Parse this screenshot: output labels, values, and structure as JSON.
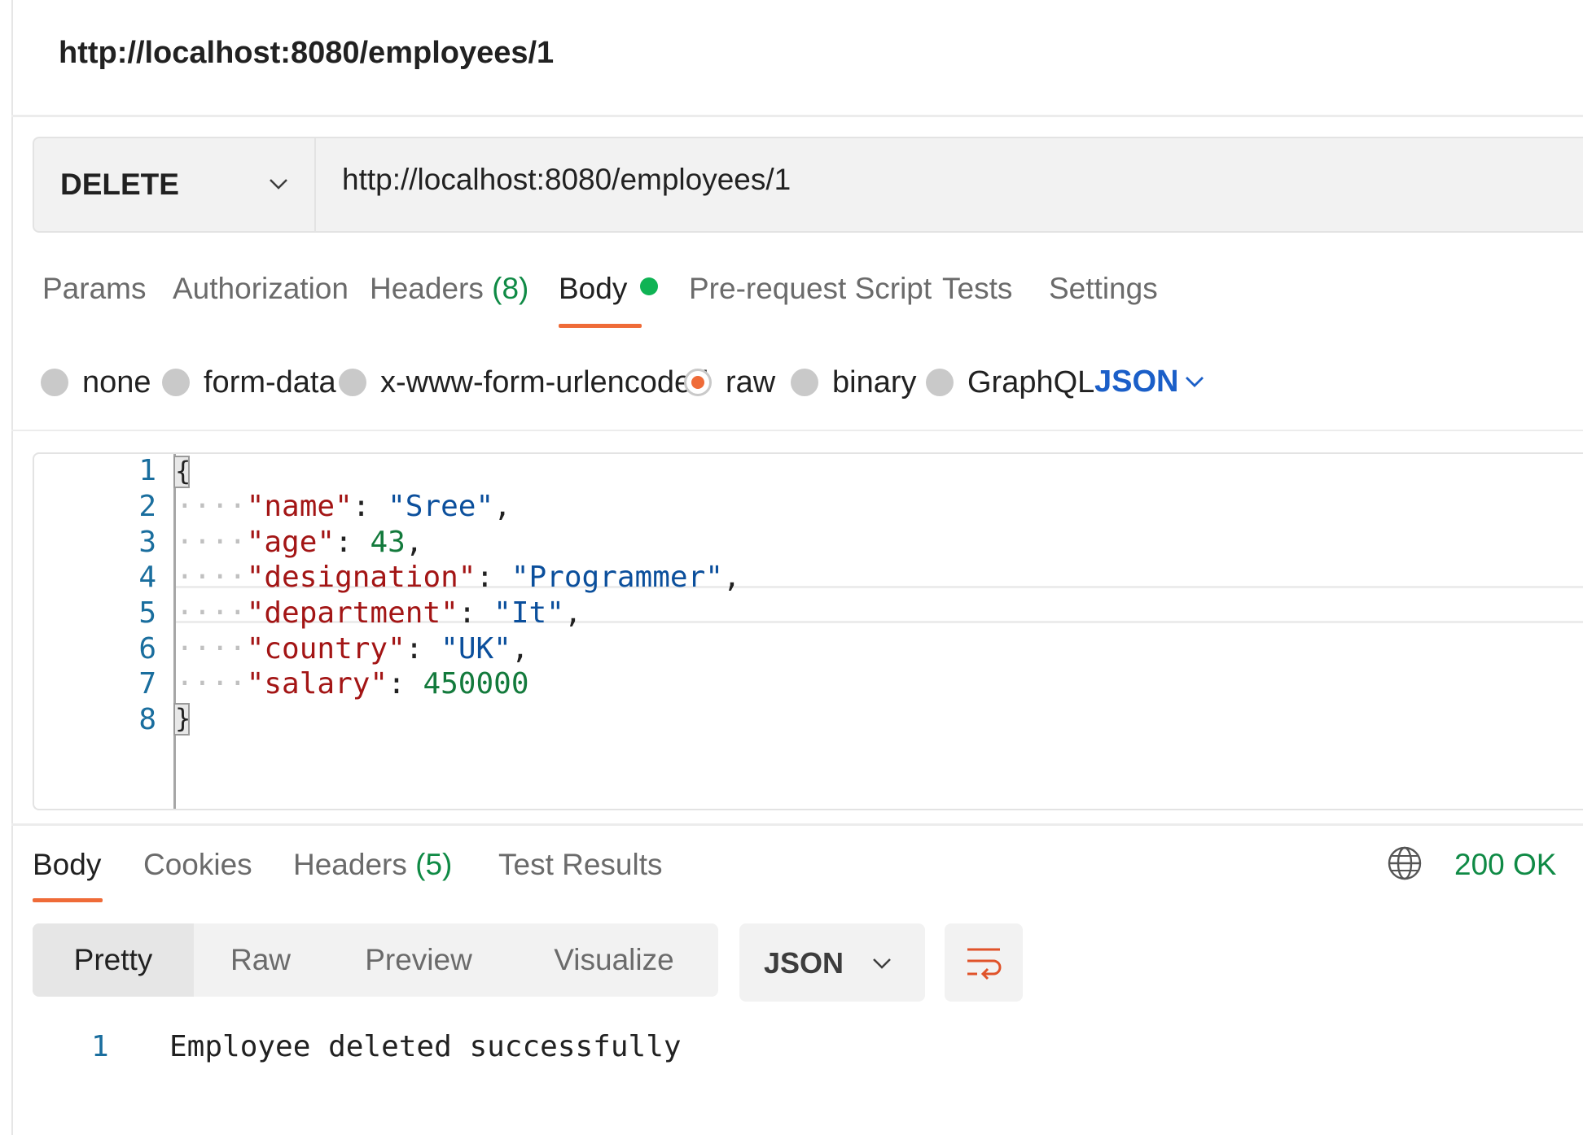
{
  "request": {
    "title": "http://localhost:8080/employees/1",
    "method": "DELETE",
    "url": "http://localhost:8080/employees/1"
  },
  "request_tabs": {
    "params": "Params",
    "authorization": "Authorization",
    "headers": "Headers",
    "headers_count": "(8)",
    "body": "Body",
    "pre_request": "Pre-request Script",
    "tests": "Tests",
    "settings": "Settings"
  },
  "body_types": {
    "none": "none",
    "form_data": "form-data",
    "urlencoded": "x-www-form-urlencoded",
    "raw": "raw",
    "binary": "binary",
    "graphql": "GraphQL",
    "language": "JSON"
  },
  "editor": {
    "line_numbers": [
      "1",
      "2",
      "3",
      "4",
      "5",
      "6",
      "7",
      "8"
    ],
    "open_brace": "{",
    "close_brace": "}",
    "lines": [
      {
        "key": "\"name\"",
        "value": "\"Sree\"",
        "type": "string",
        "comma": ","
      },
      {
        "key": "\"age\"",
        "value": "43",
        "type": "number",
        "comma": ","
      },
      {
        "key": "\"designation\"",
        "value": "\"Programmer\"",
        "type": "string",
        "comma": ","
      },
      {
        "key": "\"department\"",
        "value": "\"It\"",
        "type": "string",
        "comma": ","
      },
      {
        "key": "\"country\"",
        "value": "\"UK\"",
        "type": "string",
        "comma": ","
      },
      {
        "key": "\"salary\"",
        "value": "450000",
        "type": "number",
        "comma": ""
      }
    ]
  },
  "response_tabs": {
    "body": "Body",
    "cookies": "Cookies",
    "headers": "Headers",
    "headers_count": "(5)",
    "test_results": "Test Results",
    "status": "200 OK"
  },
  "response_view": {
    "pretty": "Pretty",
    "raw": "Raw",
    "preview": "Preview",
    "visualize": "Visualize",
    "format": "JSON"
  },
  "response_body": {
    "line_number": "1",
    "text": "Employee deleted successfully"
  },
  "icons": {
    "method_dropdown": "chevron-down-icon",
    "language_dropdown": "chevron-down-icon",
    "format_dropdown": "chevron-down-icon",
    "status": "globe-icon",
    "wrap": "wrap-lines-icon"
  },
  "colors": {
    "accent": "#ef6b38",
    "success": "#0f8a45",
    "link_blue": "#1b5fc8",
    "json_key": "#a31515",
    "json_string": "#0b4f9c",
    "json_number": "#137a3c"
  }
}
